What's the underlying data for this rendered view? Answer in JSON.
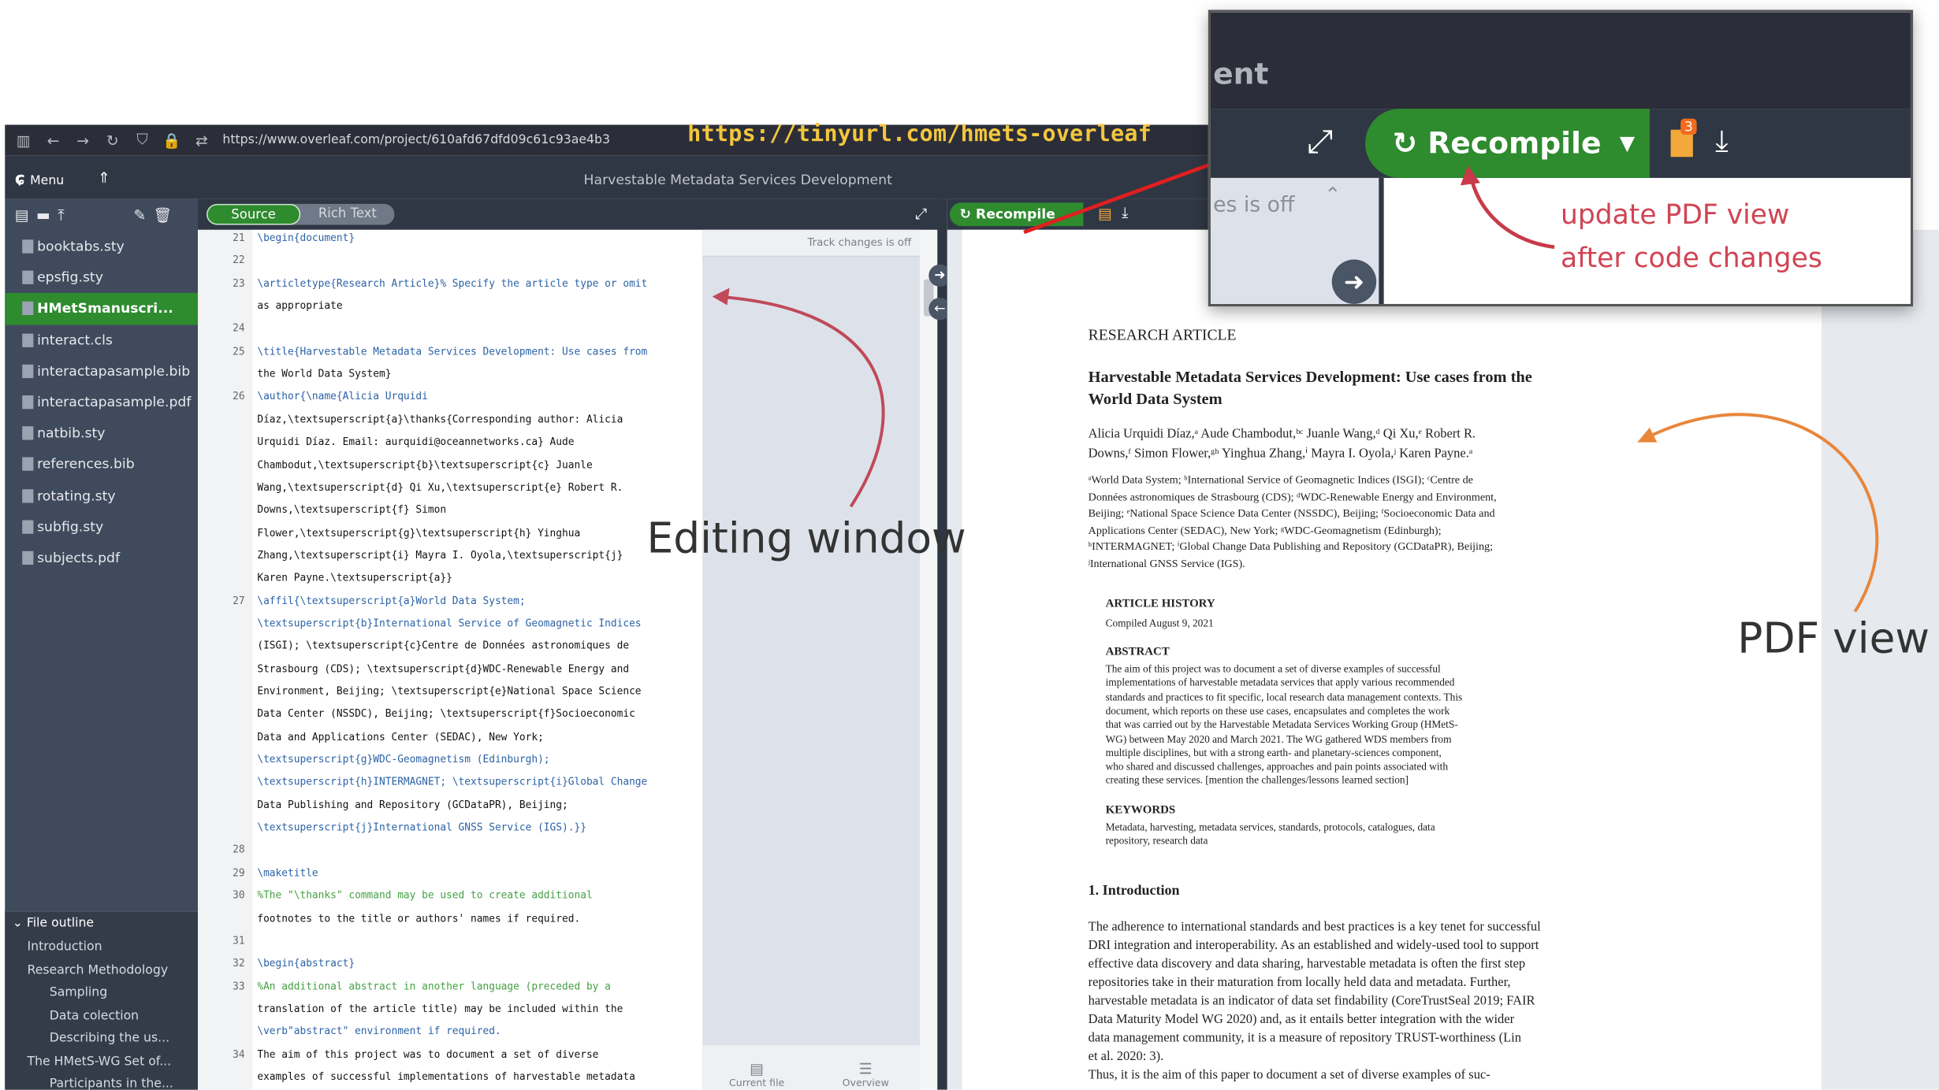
{
  "browser": {
    "url": "https://www.overleaf.com/project/610afd67dfd09c61c93ae4b3",
    "short_link": "https://tinyurl.com/hmets-overleaf"
  },
  "header": {
    "menu_label": "Menu",
    "project_title": "Harvestable Metadata Services Development"
  },
  "sidebar": {
    "files": [
      "booktabs.sty",
      "epsfig.sty",
      "HMetSmanuscri...",
      "interact.cls",
      "interactapasample.bib",
      "interactapasample.pdf",
      "natbib.sty",
      "references.bib",
      "rotating.sty",
      "subfig.sty",
      "subjects.pdf"
    ],
    "selected_index": 2,
    "outline_title": "File outline",
    "outline": [
      "Introduction",
      "Research Methodology",
      "Sampling",
      "Data colection",
      "Describing the us...",
      "The HMetS-WG Set of...",
      "Participants in the..."
    ]
  },
  "editor": {
    "source_label": "Source",
    "rich_text_label": "Rich Text",
    "track_changes": "Track changes is off",
    "current_file": "Current file",
    "overview": "Overview",
    "lines": [
      {
        "n": "21",
        "t": "\\begin{document}"
      },
      {
        "n": "22",
        "t": ""
      },
      {
        "n": "23",
        "t": "\\articletype{Research Article}% Specify the article type or omit"
      },
      {
        "n": "",
        "t": "as appropriate"
      },
      {
        "n": "24",
        "t": ""
      },
      {
        "n": "25",
        "t": "\\title{Harvestable Metadata Services Development: Use cases from"
      },
      {
        "n": "",
        "t": "the World Data System}"
      },
      {
        "n": "26",
        "t": "\\author{\\name{Alicia Urquidi"
      },
      {
        "n": "",
        "t": "Díaz,\\textsuperscript{a}\\thanks{Corresponding author: Alicia"
      },
      {
        "n": "",
        "t": "Urquidi Díaz. Email: aurquidi@oceannetworks.ca} Aude"
      },
      {
        "n": "",
        "t": "Chambodut,\\textsuperscript{b}\\textsuperscript{c} Juanle"
      },
      {
        "n": "",
        "t": "Wang,\\textsuperscript{d} Qi Xu,\\textsuperscript{e} Robert R."
      },
      {
        "n": "",
        "t": "Downs,\\textsuperscript{f} Simon"
      },
      {
        "n": "",
        "t": "Flower,\\textsuperscript{g}\\textsuperscript{h} Yinghua"
      },
      {
        "n": "",
        "t": "Zhang,\\textsuperscript{i} Mayra I. Oyola,\\textsuperscript{j}"
      },
      {
        "n": "",
        "t": "Karen Payne.\\textsuperscript{a}}"
      },
      {
        "n": "27",
        "t": "\\affil{\\textsuperscript{a}World Data System;"
      },
      {
        "n": "",
        "t": "\\textsuperscript{b}International Service of Geomagnetic Indices"
      },
      {
        "n": "",
        "t": "(ISGI); \\textsuperscript{c}Centre de Données astronomiques de"
      },
      {
        "n": "",
        "t": "Strasbourg (CDS); \\textsuperscript{d}WDC-Renewable Energy and"
      },
      {
        "n": "",
        "t": "Environment, Beijing; \\textsuperscript{e}National Space Science"
      },
      {
        "n": "",
        "t": "Data Center (NSSDC), Beijing; \\textsuperscript{f}Socioeconomic"
      },
      {
        "n": "",
        "t": "Data and Applications Center (SEDAC), New York;"
      },
      {
        "n": "",
        "t": "\\textsuperscript{g}WDC-Geomagnetism (Edinburgh);"
      },
      {
        "n": "",
        "t": "\\textsuperscript{h}INTERMAGNET; \\textsuperscript{i}Global Change"
      },
      {
        "n": "",
        "t": "Data Publishing and Repository (GCDataPR), Beijing;"
      },
      {
        "n": "",
        "t": "\\textsuperscript{j}International GNSS Service (IGS).}}"
      },
      {
        "n": "28",
        "t": ""
      },
      {
        "n": "29",
        "t": "\\maketitle"
      },
      {
        "n": "30",
        "t": "%The \"\\thanks\" command may be used to create additional"
      },
      {
        "n": "",
        "t": "footnotes to the title or authors' names if required."
      },
      {
        "n": "31",
        "t": ""
      },
      {
        "n": "32",
        "t": "\\begin{abstract}"
      },
      {
        "n": "33",
        "t": "%An additional abstract in another language (preceded by a"
      },
      {
        "n": "",
        "t": "translation of the article title) may be included within the"
      },
      {
        "n": "",
        "t": "\\verb\"abstract\" environment if required."
      },
      {
        "n": "34",
        "t": "The aim of this project was to document a set of diverse"
      },
      {
        "n": "",
        "t": "examples of successful implementations of harvestable metadata"
      }
    ]
  },
  "pdf": {
    "recompile_label": "Recompile",
    "article_type": "RESEARCH ARTICLE",
    "title_lines": [
      "Harvestable Metadata Services Development: Use cases from the",
      "World Data System"
    ],
    "author_lines": [
      "Alicia Urquidi Díaz,ᵃ Aude Chambodut,ᵇᶜ Juanle Wang,ᵈ Qi Xu,ᵉ Robert R.",
      "Downs,ᶠ Simon Flower,ᵍʰ Yinghua Zhang,ⁱ Mayra I. Oyola,ʲ Karen Payne.ᵃ"
    ],
    "affil_lines": [
      "ᵃWorld Data System; ᵇInternational Service of Geomagnetic Indices (ISGI); ᶜCentre de",
      "Données astronomiques de Strasbourg (CDS); ᵈWDC-Renewable Energy and Environment,",
      "Beijing; ᵉNational Space Science Data Center (NSSDC), Beijing; ᶠSocioeconomic Data and",
      "Applications Center (SEDAC), New York; ᵍWDC-Geomagnetism (Edinburgh);",
      "ʰINTERMAGNET; ⁱGlobal Change Data Publishing and Repository (GCDataPR), Beijing;",
      "ʲInternational GNSS Service (IGS)."
    ],
    "history_head": "ARTICLE HISTORY",
    "history": "Compiled August 9, 2021",
    "abstract_head": "ABSTRACT",
    "abstract_lines": [
      "The aim of this project was to document a set of diverse examples of successful",
      "implementations of harvestable metadata services that apply various recommended",
      "standards and practices to fit specific, local research data management contexts. This",
      "document, which reports on these use cases, encapsulates and completes the work",
      "that was carried out by the Harvestable Metadata Services Working Group (HMetS-",
      "WG) between May 2020 and March 2021. The WG gathered WDS members from",
      "multiple disciplines, but with a strong earth- and planetary-sciences component,",
      "who shared and discussed challenges, approaches and pain points associated with",
      "creating these services. [mention the challenges/lessons learned section]"
    ],
    "keywords_head": "KEYWORDS",
    "keywords_lines": [
      "Metadata, harvesting, metadata services, standards, protocols, catalogues, data",
      "repository, research data"
    ],
    "intro_head": "1.  Introduction",
    "intro_lines": [
      "The adherence to international standards and best practices is a key tenet for successful",
      "DRI integration and interoperability. As an established and widely-used tool to support",
      "effective data discovery and data sharing, harvestable metadata is often the first step",
      "repositories take in their maturation from locally held data and metadata. Further,",
      "harvestable metadata is an indicator of data set findability (CoreTrustSeal 2019; FAIR",
      "Data Maturity Model WG 2020) and, as it entails better integration with the wider",
      "data management community, it is a measure of repository TRUST-worthiness (Lin",
      "et al. 2020: 3).",
      "Thus, it is the aim of this paper to document a set of diverse examples of suc-"
    ]
  },
  "zoom": {
    "tab_fragment": "ent",
    "track_fragment": "es is off",
    "recompile_label": "Recompile",
    "badge": "3"
  },
  "annotations": {
    "editing": "Editing window",
    "pdf": "PDF view",
    "update_line1": "update PDF view",
    "update_line2": "after code changes"
  }
}
